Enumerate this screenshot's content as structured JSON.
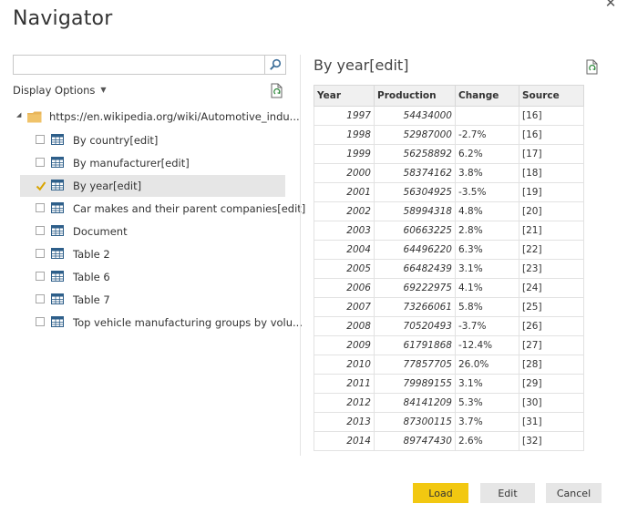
{
  "window": {
    "title": "Navigator"
  },
  "search": {
    "placeholder": "",
    "value": ""
  },
  "display_options": {
    "label": "Display Options"
  },
  "tree": {
    "root_label": "https://en.wikipedia.org/wiki/Automotive_indu...",
    "items": [
      {
        "label": "By country[edit]",
        "checked": false,
        "selected": false
      },
      {
        "label": "By manufacturer[edit]",
        "checked": false,
        "selected": false
      },
      {
        "label": "By year[edit]",
        "checked": true,
        "selected": true
      },
      {
        "label": "Car makes and their parent companies[edit]",
        "checked": false,
        "selected": false
      },
      {
        "label": "Document",
        "checked": false,
        "selected": false
      },
      {
        "label": "Table 2",
        "checked": false,
        "selected": false
      },
      {
        "label": "Table 6",
        "checked": false,
        "selected": false
      },
      {
        "label": "Table 7",
        "checked": false,
        "selected": false
      },
      {
        "label": "Top vehicle manufacturing groups by volu...",
        "checked": false,
        "selected": false
      }
    ]
  },
  "preview": {
    "title": "By year[edit]",
    "columns": [
      "Year",
      "Production",
      "Change",
      "Source"
    ],
    "rows": [
      [
        "1997",
        "54434000",
        "",
        "[16]"
      ],
      [
        "1998",
        "52987000",
        "-2.7%",
        "[16]"
      ],
      [
        "1999",
        "56258892",
        "6.2%",
        "[17]"
      ],
      [
        "2000",
        "58374162",
        "3.8%",
        "[18]"
      ],
      [
        "2001",
        "56304925",
        "-3.5%",
        "[19]"
      ],
      [
        "2002",
        "58994318",
        "4.8%",
        "[20]"
      ],
      [
        "2003",
        "60663225",
        "2.8%",
        "[21]"
      ],
      [
        "2004",
        "64496220",
        "6.3%",
        "[22]"
      ],
      [
        "2005",
        "66482439",
        "3.1%",
        "[23]"
      ],
      [
        "2006",
        "69222975",
        "4.1%",
        "[24]"
      ],
      [
        "2007",
        "73266061",
        "5.8%",
        "[25]"
      ],
      [
        "2008",
        "70520493",
        "-3.7%",
        "[26]"
      ],
      [
        "2009",
        "61791868",
        "-12.4%",
        "[27]"
      ],
      [
        "2010",
        "77857705",
        "26.0%",
        "[28]"
      ],
      [
        "2011",
        "79989155",
        "3.1%",
        "[29]"
      ],
      [
        "2012",
        "84141209",
        "5.3%",
        "[30]"
      ],
      [
        "2013",
        "87300115",
        "3.7%",
        "[31]"
      ],
      [
        "2014",
        "89747430",
        "2.6%",
        "[32]"
      ]
    ]
  },
  "buttons": {
    "load": "Load",
    "edit": "Edit",
    "cancel": "Cancel"
  },
  "colors": {
    "accent": "#f2c811",
    "selected_row": "#e6e6e6",
    "table_icon": "#2e5f8a"
  }
}
